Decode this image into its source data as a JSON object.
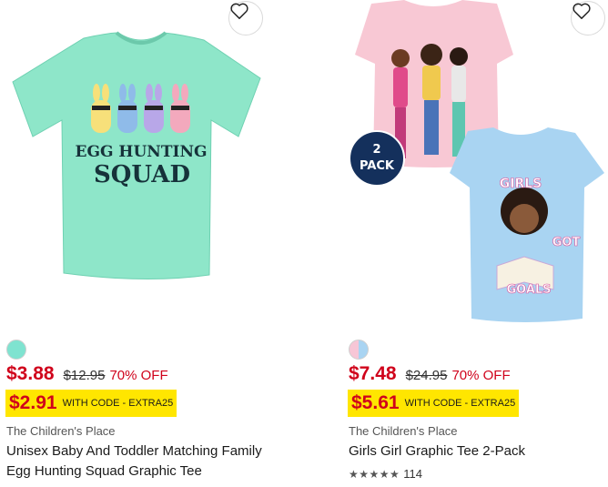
{
  "products": [
    {
      "swatch_colors": [
        "#7fe3d0"
      ],
      "sale_price": "$3.88",
      "original_price": "$12.95",
      "discount": "70% OFF",
      "promo_price": "$2.91",
      "promo_text": "WITH CODE - ",
      "promo_code": "EXTRA25",
      "brand": "The Children's Place",
      "title": "Unisex Baby And Toddler Matching Family Egg Hunting Squad Graphic Tee",
      "image_text_line1": "EGG HUNTING",
      "image_text_line2": "SQUAD"
    },
    {
      "swatch_colors": [
        "#f7c6d6",
        "#a9d4f2"
      ],
      "sale_price": "$7.48",
      "original_price": "$24.95",
      "discount": "70% OFF",
      "promo_price": "$5.61",
      "promo_text": "WITH CODE - ",
      "promo_code": "EXTRA25",
      "brand": "The Children's Place",
      "title": "Girls Girl Graphic Tee 2-Pack",
      "badge_line1": "2",
      "badge_line2": "PACK",
      "image_text_girls": "GIRLS",
      "image_text_got": "GOT",
      "image_text_goals": "GOALS",
      "rating_stars": "★★★★★",
      "rating_value": 5,
      "review_count": "114"
    }
  ],
  "icons": {
    "favorite": "heart-outline-icon",
    "star": "star-icon"
  },
  "colors": {
    "sale_red": "#d0021b",
    "promo_yellow": "#ffe600"
  }
}
